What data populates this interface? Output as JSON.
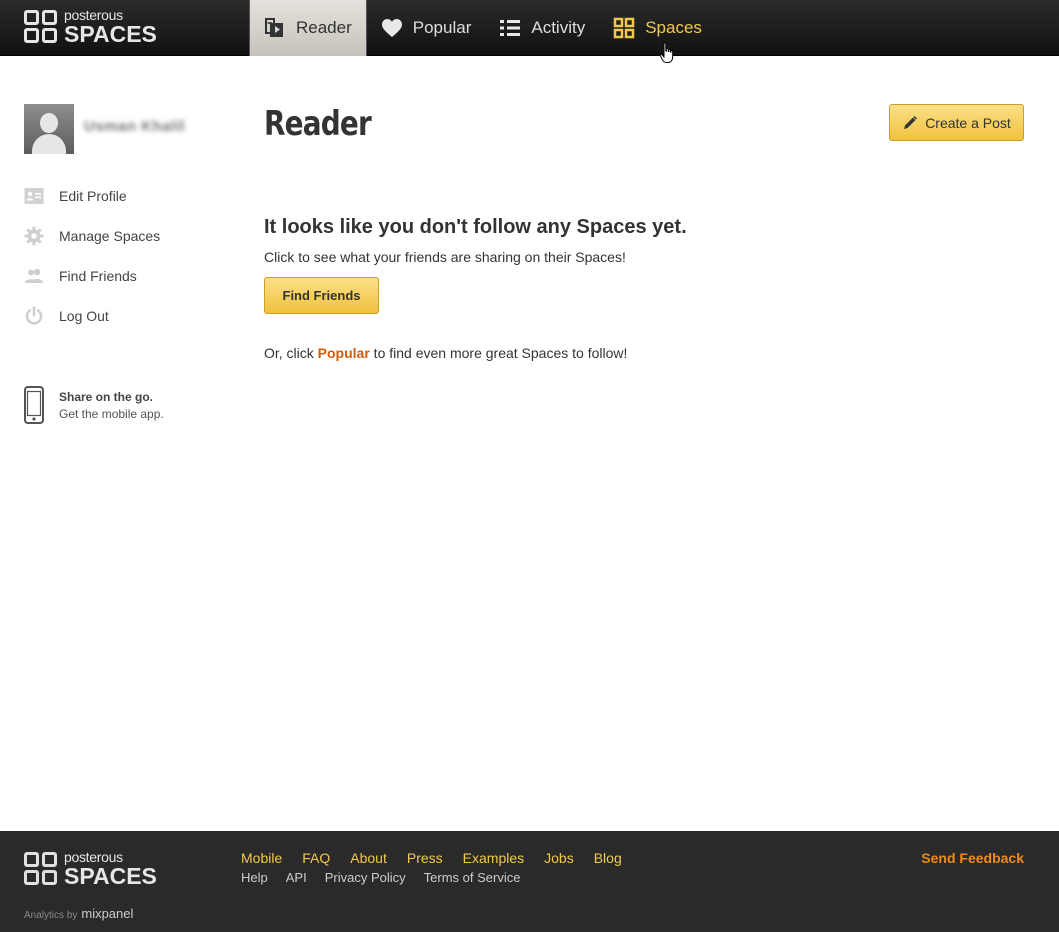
{
  "header": {
    "logo_small": "posterous",
    "logo_large": "SPACES",
    "nav": [
      {
        "label": "Reader",
        "icon": "reader-icon",
        "active": true
      },
      {
        "label": "Popular",
        "icon": "heart-icon"
      },
      {
        "label": "Activity",
        "icon": "list-icon"
      },
      {
        "label": "Spaces",
        "icon": "grid-icon",
        "hover": true
      }
    ]
  },
  "sidebar": {
    "username": "Usman Khalil",
    "items": [
      {
        "label": "Edit Profile",
        "icon": "profile-card-icon"
      },
      {
        "label": "Manage Spaces",
        "icon": "gear-icon"
      },
      {
        "label": "Find Friends",
        "icon": "friends-icon"
      },
      {
        "label": "Log Out",
        "icon": "power-icon"
      }
    ],
    "mobile": {
      "title": "Share on the go.",
      "subtitle": "Get the mobile app."
    }
  },
  "main": {
    "title": "Reader",
    "create_label": "Create a Post",
    "empty_title": "It looks like you don't follow any Spaces yet.",
    "empty_sub": "Click to see what your friends are sharing on their Spaces!",
    "find_friends_label": "Find Friends",
    "or_prefix": "Or, click ",
    "or_link": "Popular",
    "or_suffix": " to find even more great Spaces to follow!"
  },
  "footer": {
    "logo_small": "posterous",
    "logo_large": "SPACES",
    "analytics_label": "Analytics by",
    "analytics_brand": "mixpanel",
    "primary_links": [
      "Mobile",
      "FAQ",
      "About",
      "Press",
      "Examples",
      "Jobs",
      "Blog"
    ],
    "secondary_links": [
      "Help",
      "API",
      "Privacy Policy",
      "Terms of Service"
    ],
    "feedback_label": "Send Feedback"
  },
  "colors": {
    "accent_yellow": "#f2c94c",
    "link_orange": "#d25d0c",
    "feedback_orange": "#f08a1c",
    "topbar": "#1c1c1c",
    "footer": "#2a2a2a"
  }
}
